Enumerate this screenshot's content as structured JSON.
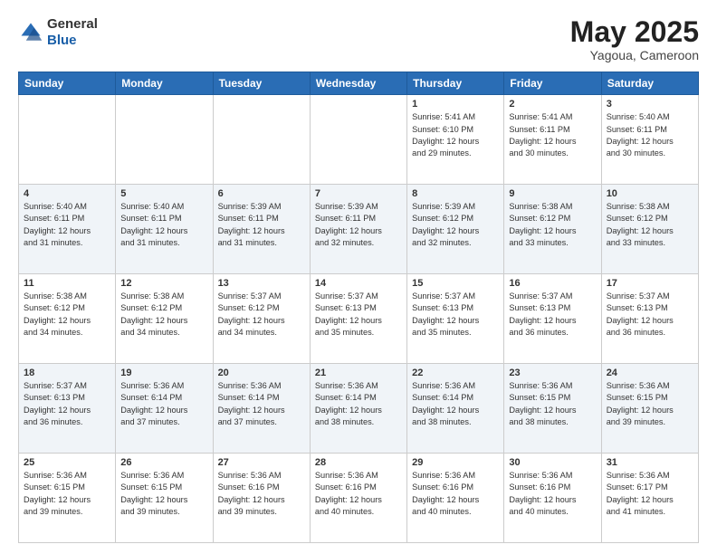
{
  "header": {
    "logo": {
      "general": "General",
      "blue": "Blue"
    },
    "title": "May 2025",
    "location": "Yagoua, Cameroon"
  },
  "calendar": {
    "days_of_week": [
      "Sunday",
      "Monday",
      "Tuesday",
      "Wednesday",
      "Thursday",
      "Friday",
      "Saturday"
    ],
    "weeks": [
      [
        {
          "day": "",
          "info": ""
        },
        {
          "day": "",
          "info": ""
        },
        {
          "day": "",
          "info": ""
        },
        {
          "day": "",
          "info": ""
        },
        {
          "day": "1",
          "info": "Sunrise: 5:41 AM\nSunset: 6:10 PM\nDaylight: 12 hours\nand 29 minutes."
        },
        {
          "day": "2",
          "info": "Sunrise: 5:41 AM\nSunset: 6:11 PM\nDaylight: 12 hours\nand 30 minutes."
        },
        {
          "day": "3",
          "info": "Sunrise: 5:40 AM\nSunset: 6:11 PM\nDaylight: 12 hours\nand 30 minutes."
        }
      ],
      [
        {
          "day": "4",
          "info": "Sunrise: 5:40 AM\nSunset: 6:11 PM\nDaylight: 12 hours\nand 31 minutes."
        },
        {
          "day": "5",
          "info": "Sunrise: 5:40 AM\nSunset: 6:11 PM\nDaylight: 12 hours\nand 31 minutes."
        },
        {
          "day": "6",
          "info": "Sunrise: 5:39 AM\nSunset: 6:11 PM\nDaylight: 12 hours\nand 31 minutes."
        },
        {
          "day": "7",
          "info": "Sunrise: 5:39 AM\nSunset: 6:11 PM\nDaylight: 12 hours\nand 32 minutes."
        },
        {
          "day": "8",
          "info": "Sunrise: 5:39 AM\nSunset: 6:12 PM\nDaylight: 12 hours\nand 32 minutes."
        },
        {
          "day": "9",
          "info": "Sunrise: 5:38 AM\nSunset: 6:12 PM\nDaylight: 12 hours\nand 33 minutes."
        },
        {
          "day": "10",
          "info": "Sunrise: 5:38 AM\nSunset: 6:12 PM\nDaylight: 12 hours\nand 33 minutes."
        }
      ],
      [
        {
          "day": "11",
          "info": "Sunrise: 5:38 AM\nSunset: 6:12 PM\nDaylight: 12 hours\nand 34 minutes."
        },
        {
          "day": "12",
          "info": "Sunrise: 5:38 AM\nSunset: 6:12 PM\nDaylight: 12 hours\nand 34 minutes."
        },
        {
          "day": "13",
          "info": "Sunrise: 5:37 AM\nSunset: 6:12 PM\nDaylight: 12 hours\nand 34 minutes."
        },
        {
          "day": "14",
          "info": "Sunrise: 5:37 AM\nSunset: 6:13 PM\nDaylight: 12 hours\nand 35 minutes."
        },
        {
          "day": "15",
          "info": "Sunrise: 5:37 AM\nSunset: 6:13 PM\nDaylight: 12 hours\nand 35 minutes."
        },
        {
          "day": "16",
          "info": "Sunrise: 5:37 AM\nSunset: 6:13 PM\nDaylight: 12 hours\nand 36 minutes."
        },
        {
          "day": "17",
          "info": "Sunrise: 5:37 AM\nSunset: 6:13 PM\nDaylight: 12 hours\nand 36 minutes."
        }
      ],
      [
        {
          "day": "18",
          "info": "Sunrise: 5:37 AM\nSunset: 6:13 PM\nDaylight: 12 hours\nand 36 minutes."
        },
        {
          "day": "19",
          "info": "Sunrise: 5:36 AM\nSunset: 6:14 PM\nDaylight: 12 hours\nand 37 minutes."
        },
        {
          "day": "20",
          "info": "Sunrise: 5:36 AM\nSunset: 6:14 PM\nDaylight: 12 hours\nand 37 minutes."
        },
        {
          "day": "21",
          "info": "Sunrise: 5:36 AM\nSunset: 6:14 PM\nDaylight: 12 hours\nand 38 minutes."
        },
        {
          "day": "22",
          "info": "Sunrise: 5:36 AM\nSunset: 6:14 PM\nDaylight: 12 hours\nand 38 minutes."
        },
        {
          "day": "23",
          "info": "Sunrise: 5:36 AM\nSunset: 6:15 PM\nDaylight: 12 hours\nand 38 minutes."
        },
        {
          "day": "24",
          "info": "Sunrise: 5:36 AM\nSunset: 6:15 PM\nDaylight: 12 hours\nand 39 minutes."
        }
      ],
      [
        {
          "day": "25",
          "info": "Sunrise: 5:36 AM\nSunset: 6:15 PM\nDaylight: 12 hours\nand 39 minutes."
        },
        {
          "day": "26",
          "info": "Sunrise: 5:36 AM\nSunset: 6:15 PM\nDaylight: 12 hours\nand 39 minutes."
        },
        {
          "day": "27",
          "info": "Sunrise: 5:36 AM\nSunset: 6:16 PM\nDaylight: 12 hours\nand 39 minutes."
        },
        {
          "day": "28",
          "info": "Sunrise: 5:36 AM\nSunset: 6:16 PM\nDaylight: 12 hours\nand 40 minutes."
        },
        {
          "day": "29",
          "info": "Sunrise: 5:36 AM\nSunset: 6:16 PM\nDaylight: 12 hours\nand 40 minutes."
        },
        {
          "day": "30",
          "info": "Sunrise: 5:36 AM\nSunset: 6:16 PM\nDaylight: 12 hours\nand 40 minutes."
        },
        {
          "day": "31",
          "info": "Sunrise: 5:36 AM\nSunset: 6:17 PM\nDaylight: 12 hours\nand 41 minutes."
        }
      ]
    ]
  }
}
